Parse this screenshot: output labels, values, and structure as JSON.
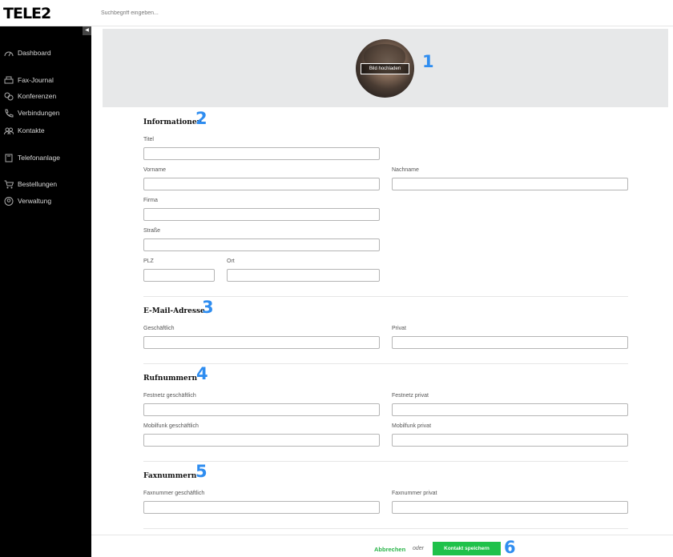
{
  "brand": {
    "logo": "TELE2"
  },
  "search": {
    "placeholder": "Suchbegriff eingeben..."
  },
  "sidebar": {
    "collapse_icon": "◀",
    "items": [
      {
        "label": "Dashboard",
        "icon": "dashboard-icon"
      },
      {
        "label": "Fax-Journal",
        "icon": "fax-icon"
      },
      {
        "label": "Konferenzen",
        "icon": "conference-icon"
      },
      {
        "label": "Verbindungen",
        "icon": "phone-icon"
      },
      {
        "label": "Kontakte",
        "icon": "contacts-icon"
      },
      {
        "label": "Telefonanlage",
        "icon": "pbx-icon"
      },
      {
        "label": "Bestellungen",
        "icon": "cart-icon"
      },
      {
        "label": "Verwaltung",
        "icon": "user-settings-icon"
      }
    ]
  },
  "avatar": {
    "upload_label": "Bild hochladen"
  },
  "markers": [
    "1",
    "2",
    "3",
    "4",
    "5",
    "6"
  ],
  "sections": {
    "info": {
      "title": "Informationen",
      "titel": "Titel",
      "vorname": "Vorname",
      "nachname": "Nachname",
      "firma": "Firma",
      "strasse": "Straße",
      "plz": "PLZ",
      "ort": "Ort"
    },
    "email": {
      "title": "E-Mail-Adresse",
      "business": "Geschäftlich",
      "private": "Privat"
    },
    "phone": {
      "title": "Rufnummern",
      "landline_business": "Festnetz geschäftlich",
      "landline_private": "Festnetz privat",
      "mobile_business": "Mobilfunk geschäftlich",
      "mobile_private": "Mobilfunk privat"
    },
    "fax": {
      "title": "Faxnummern",
      "business": "Faxnummer geschäftlich",
      "private": "Faxnummer privat"
    }
  },
  "footer": {
    "cancel": "Abbrechen",
    "or": "oder",
    "save": "Kontakt speichern"
  },
  "colors": {
    "accent_green": "#1fc14a",
    "marker_blue": "#2f8df0",
    "sidebar_bg": "#000000"
  }
}
